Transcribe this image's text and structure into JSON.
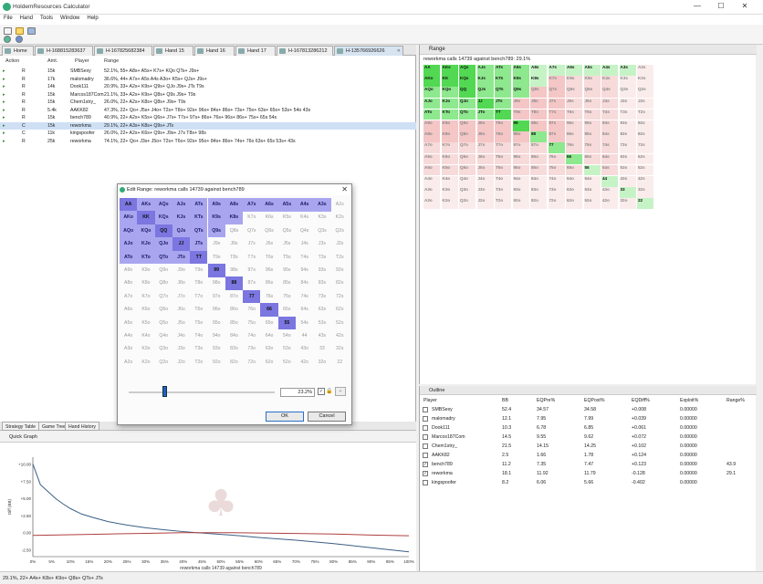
{
  "window": {
    "title": "HoldemResources Calculator",
    "minimize": "—",
    "maximize": "☐",
    "close": "✕"
  },
  "menu": [
    "File",
    "Hand",
    "Tools",
    "Window",
    "Help"
  ],
  "tabs": [
    {
      "label": "Home"
    },
    {
      "label": "H-168815283637"
    },
    {
      "label": "H-167825682384"
    },
    {
      "label": "Hand 15"
    },
    {
      "label": "Hand 16"
    },
    {
      "label": "Hand 17"
    },
    {
      "label": "H-167813286212"
    },
    {
      "label": "H-135766926626"
    }
  ],
  "action_table": {
    "headers": [
      "Action",
      "Amt.",
      "Player",
      "Range"
    ],
    "rows": [
      {
        "action": "R",
        "amt": "15k",
        "player": "SMBSexy",
        "range": "52.1%, 55+ A8s+ A5s+ K7s+ KQo QTs+ J9s+"
      },
      {
        "action": "R",
        "amt": "17k",
        "player": "malomadry",
        "range": "36.6%, 44+ A7s+ A5s A4s A3o+ K5s+ QJs+ J9s+"
      },
      {
        "action": "R",
        "amt": "14k",
        "player": "Dook111",
        "range": "20.9%, 33+ A2s+ K9s+ Q9s+ QJo J9s+ JTs T9s"
      },
      {
        "action": "R",
        "amt": "15k",
        "player": "Marcos187Com",
        "range": "21.1%, 33+ A2s+ K9s+ Q8s+ Q9s J9s+ T9s"
      },
      {
        "action": "R",
        "amt": "15k",
        "player": "Chem1stry_",
        "range": "26.0%, 22+ A2s+ K8s+ Q8s+ J9s+ T9s"
      },
      {
        "action": "R",
        "amt": "5.4k",
        "player": "AAKK82",
        "range": "47.3%, 22+ Qo+ J5s+ J4o+ T2s+ T8o+ 92s+ 96o+ 84s+ 86o+ 73s+ 75o+ 63s+ 65o+ 53s+ 54o 43s"
      },
      {
        "action": "R",
        "amt": "15k",
        "player": "bench789",
        "range": "40.9%, 22+ A2s+ K5s+ Q6s+ J7s+ T7s+ 97s+ 86s+ 76s+ 96s+ 86s+ 75s+ 65s 54s"
      },
      {
        "action": "C",
        "amt": "15k",
        "player": "reworkma",
        "range": "29.1%, 22+ A3s+ K8s+ Q9s+ JTs"
      },
      {
        "action": "C",
        "amt": "11k",
        "player": "kingspoofer",
        "range": "26.0%, 22+ A2s+ K6s+ Q9s+ J9s+ J7s T8s+ 98s"
      },
      {
        "action": "R",
        "amt": "25k",
        "player": "reworkma",
        "range": "74.1%, 22+ Qo+ J3s+ J5o+ T2s+ T6o+ 92s+ 95o+ 84s+ 86o+ 74s+ 76o 63s+ 65s 53s+ 43s"
      }
    ]
  },
  "bottom_tabs": [
    "Strategy Table",
    "Game Tree",
    "Hand History"
  ],
  "graph": {
    "title": "Quick Graph",
    "xlabel": "reworkma calls 14739 against bench789",
    "ylabel": "Diff (BB)",
    "watermark": "♣"
  },
  "chart_data": {
    "type": "line",
    "xlabel": "reworkma calls 14739 against bench789",
    "ylabel": "Diff (BB)",
    "x_ticks": [
      "0%",
      "5%",
      "10%",
      "15%",
      "20%",
      "25%",
      "30%",
      "35%",
      "40%",
      "45%",
      "50%",
      "55%",
      "60%",
      "65%",
      "70%",
      "75%",
      "80%",
      "85%",
      "90%",
      "95%",
      "100%"
    ],
    "y_ticks": [
      "+10.00",
      "+7.50",
      "+5.00",
      "+2.50",
      "0.00",
      "-2.50"
    ],
    "xlim": [
      0,
      100
    ],
    "ylim": [
      -3.5,
      11
    ],
    "grid": false,
    "series": [
      {
        "color": "#3a5f85",
        "x": [
          0,
          1,
          2,
          4,
          6,
          8,
          10,
          13,
          16,
          20,
          25,
          30,
          35,
          40,
          45,
          50,
          55,
          60,
          65,
          70,
          75,
          80,
          85,
          90,
          95,
          100
        ],
        "y": [
          10,
          8.5,
          7,
          6,
          5,
          4.2,
          3.5,
          2.7,
          2.2,
          1.6,
          1.1,
          0.7,
          0.4,
          0.15,
          -0.05,
          -0.25,
          -0.45,
          -0.7,
          -0.9,
          -1.1,
          -1.35,
          -1.6,
          -1.9,
          -2.2,
          -2.5,
          -2.8
        ]
      },
      {
        "color": "#b04040",
        "x": [
          0,
          5,
          10,
          20,
          30,
          40,
          50,
          60,
          70,
          80,
          90,
          100
        ],
        "y": [
          -0.4,
          -0.35,
          -0.3,
          -0.2,
          -0.1,
          0.0,
          0.0,
          -0.05,
          -0.12,
          -0.2,
          -0.35,
          -0.45
        ]
      }
    ]
  },
  "range_panel": {
    "title": "Range",
    "subtitle": "reworkma calls 14739 against bench789: 29.1%",
    "ranks": [
      "A",
      "K",
      "Q",
      "J",
      "T",
      "9",
      "8",
      "7",
      "6",
      "5",
      "4",
      "3",
      "2"
    ]
  },
  "outline": {
    "title": "Outline",
    "headers": [
      "Player",
      "BB",
      "EQPre%",
      "EQPost%",
      "EQDiff%",
      "Exploit%",
      "Range%"
    ],
    "rows": [
      {
        "checked": false,
        "player": "SMBSexy",
        "bb": "52.4",
        "eqpre": "34.57",
        "eqpost": "34.58",
        "eqdiff": "+0.008",
        "exploit": "0.00000",
        "range": ""
      },
      {
        "checked": false,
        "player": "malomadry",
        "bb": "12.1",
        "eqpre": "7.95",
        "eqpost": "7.99",
        "eqdiff": "+0.039",
        "exploit": "0.00000",
        "range": ""
      },
      {
        "checked": false,
        "player": "Dook111",
        "bb": "10.3",
        "eqpre": "6.78",
        "eqpost": "6.85",
        "eqdiff": "+0.061",
        "exploit": "0.00000",
        "range": ""
      },
      {
        "checked": false,
        "player": "Marcos187Com",
        "bb": "14.5",
        "eqpre": "9.55",
        "eqpost": "9.62",
        "eqdiff": "+0.072",
        "exploit": "0.00000",
        "range": ""
      },
      {
        "checked": false,
        "player": "Chem1stry_",
        "bb": "21.5",
        "eqpre": "14.15",
        "eqpost": "14.25",
        "eqdiff": "+0.102",
        "exploit": "0.00000",
        "range": ""
      },
      {
        "checked": false,
        "player": "AAKK82",
        "bb": "2.5",
        "eqpre": "1.66",
        "eqpost": "1.78",
        "eqdiff": "+0.124",
        "exploit": "0.00000",
        "range": ""
      },
      {
        "checked": true,
        "player": "bench789",
        "bb": "11.2",
        "eqpre": "7.35",
        "eqpost": "7.47",
        "eqdiff": "+0.123",
        "exploit": "0.00000",
        "range": "43.9"
      },
      {
        "checked": true,
        "player": "reworkma",
        "bb": "18.1",
        "eqpre": "11.92",
        "eqpost": "11.79",
        "eqdiff": "-0.128",
        "exploit": "0.00000",
        "range": "29.1"
      },
      {
        "checked": false,
        "player": "kingspoofer",
        "bb": "8.2",
        "eqpre": "6.06",
        "eqpost": "5.66",
        "eqdiff": "-0.402",
        "exploit": "0.00000",
        "range": ""
      }
    ]
  },
  "dialog": {
    "title": "Edit Range: reworkma calls 14739 against bench789",
    "percent": "23.2%",
    "slider_fraction": 0.23,
    "ok": "OK",
    "cancel": "Cancel",
    "lock_icon": "🔒"
  },
  "status": "29.1%, 22+ A4s+ K8s+ K9o+ Q8s+ QTs+ JTs",
  "colors": {
    "selection": "#cfe0f5",
    "range_on": "#a9a6ef",
    "range_pair": "#7b76e0",
    "ev_plus": "#6fe36f",
    "ev_minus": "#f2a3a3"
  }
}
